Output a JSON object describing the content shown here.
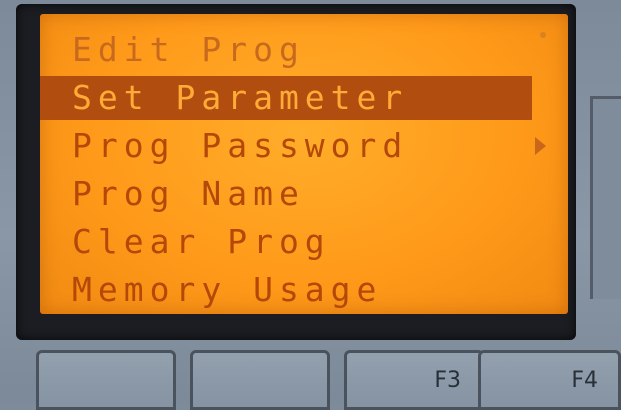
{
  "menu": {
    "items": [
      {
        "label": "Edit Prog"
      },
      {
        "label": "Set Parameter",
        "selected": true
      },
      {
        "label": "Prog Password",
        "submenu": true
      },
      {
        "label": "Prog Name"
      },
      {
        "label": "Clear Prog"
      },
      {
        "label": "Memory Usage"
      }
    ]
  },
  "function_keys": {
    "f1": "",
    "f2": "",
    "f3": "F3",
    "f4": "F4"
  },
  "colors": {
    "lcd_background": "#ff9a1a",
    "text": "#b34808",
    "highlight_background": "#b24d10",
    "highlight_text": "#ffab36",
    "bezel": "#1b1d22",
    "housing": "#8a97a6"
  },
  "icons": {
    "submenu_indicator": "right-triangle-icon"
  }
}
